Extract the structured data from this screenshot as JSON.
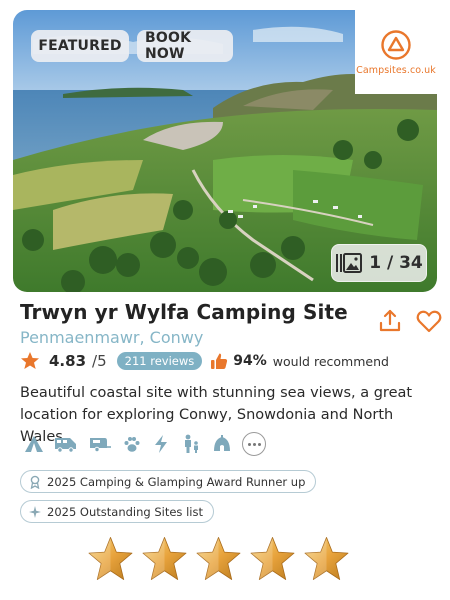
{
  "hero": {
    "featured_label": "FEATURED",
    "book_label": "BOOK NOW",
    "photo_index": "1 / 34"
  },
  "logo": {
    "text": "Campsites.co.uk",
    "color": "#e9772c"
  },
  "site": {
    "name": "Trwyn yr Wylfa Camping Site",
    "location": "Penmaenmawr, Conwy",
    "rating": "4.83",
    "rating_max": "/5",
    "reviews": "211 reviews",
    "recommend_pct": "94%",
    "recommend_text": "would recommend",
    "description": "Beautiful coastal site with stunning sea views, a great location for exploring Conwy, Snowdonia and North Wales."
  },
  "amenities": [
    "tent-icon",
    "motorhome-icon",
    "caravan-icon",
    "pets-icon",
    "electric-hookup-icon",
    "family-icon",
    "glamping-icon",
    "more-icon"
  ],
  "awards": [
    {
      "label": "2025 Camping & Glamping Award Runner up",
      "icon": "award-ribbon-icon"
    },
    {
      "label": "2025 Outstanding Sites list",
      "icon": "sparkle-icon"
    }
  ],
  "stars": {
    "count": 5,
    "filled": 5,
    "color": "#e8a33c"
  },
  "colors": {
    "accent": "#e9772c",
    "secondary": "#86b6c7",
    "pill": "#7fb1c4"
  }
}
